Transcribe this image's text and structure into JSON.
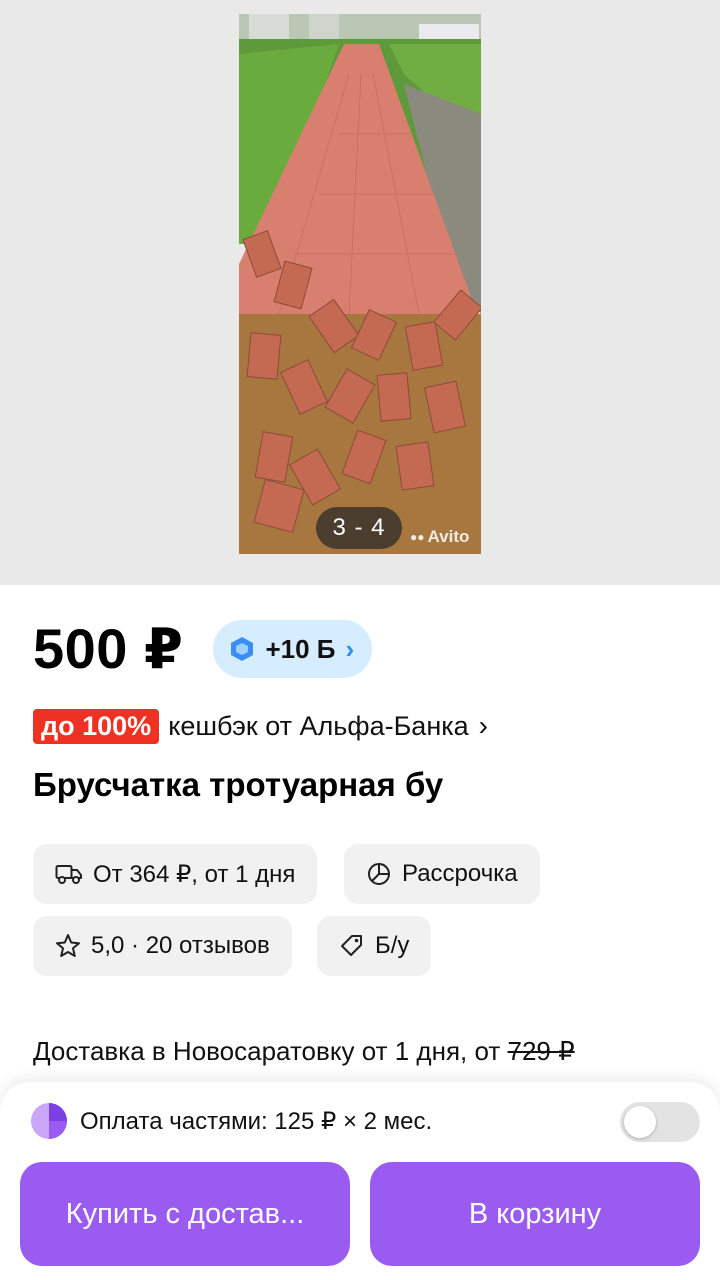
{
  "gallery": {
    "counter": "3 - 4",
    "watermark": "Avito"
  },
  "listing": {
    "price": "500 ₽",
    "bonus_label": "+10 Б",
    "cashback_badge": "до 100%",
    "cashback_text": "кешбэк от Альфа-Банка",
    "title": "Брусчатка тротуарная бу"
  },
  "chips": {
    "delivery": "От 364 ₽, от 1 дня",
    "installment": "Рассрочка",
    "rating": "5,0 · 20 отзывов",
    "condition": "Б/у"
  },
  "delivery_line": {
    "text": "Доставка в Новосаратовку от 1 дня, от ",
    "old_price": "729 ₽"
  },
  "bottom": {
    "installment_text": "Оплата частями: 125 ₽ × 2 мес.",
    "installment_enabled": false,
    "buy_button": "Купить с достав...",
    "cart_button": "В корзину"
  },
  "colors": {
    "accent": "#9a5cf0",
    "cashback_red": "#ef3124",
    "bonus_bg": "#d6ecff",
    "chip_bg": "#f1f1f1"
  }
}
